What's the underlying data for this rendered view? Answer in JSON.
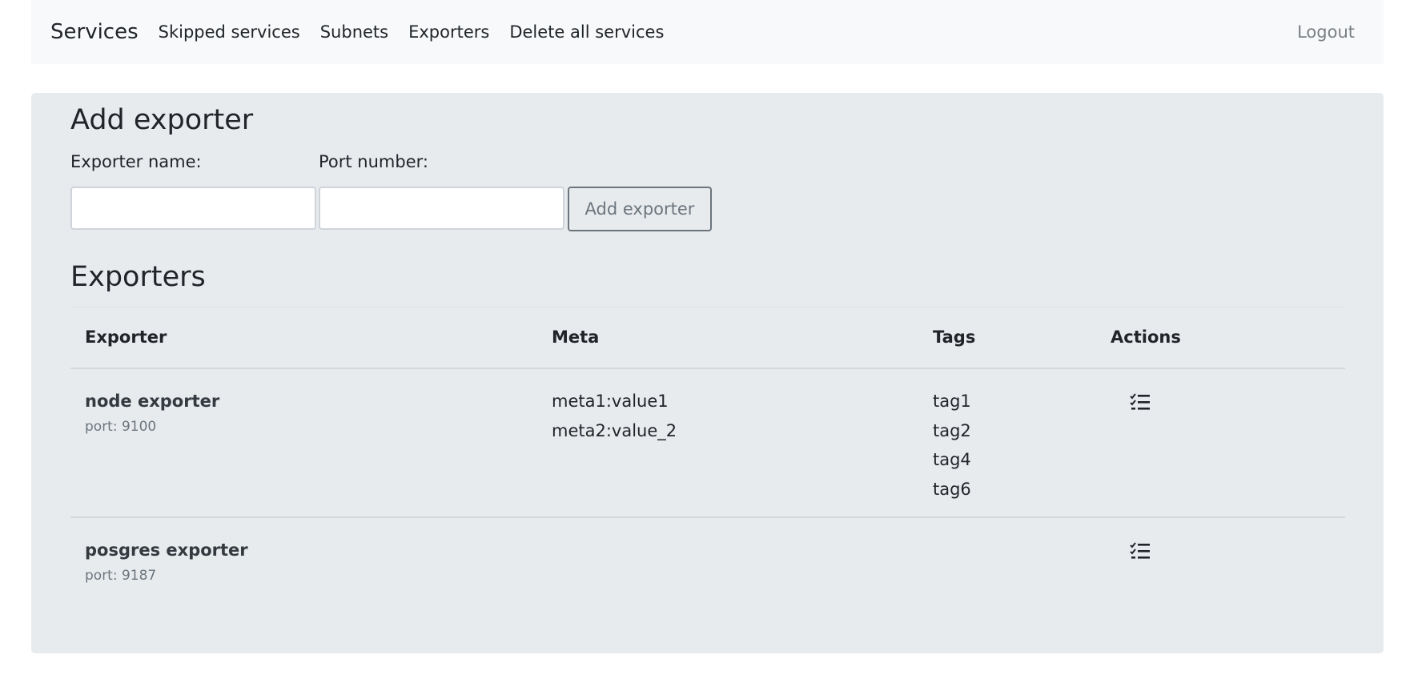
{
  "navbar": {
    "brand": "Services",
    "links": [
      "Skipped services",
      "Subnets",
      "Exporters",
      "Delete all services"
    ],
    "logout": "Logout"
  },
  "add_form": {
    "title": "Add exporter",
    "name_label": "Exporter name:",
    "port_label": "Port number:",
    "name_value": "",
    "port_value": "",
    "submit_label": "Add exporter"
  },
  "exporters": {
    "title": "Exporters",
    "columns": [
      "Exporter",
      "Meta",
      "Tags",
      "Actions"
    ],
    "rows": [
      {
        "name": "node exporter",
        "port": "port: 9100",
        "meta": [
          "meta1:value1",
          "meta2:value_2"
        ],
        "tags": [
          "tag1",
          "tag2",
          "tag4",
          "tag6"
        ],
        "action_icon": "checklist-icon"
      },
      {
        "name": "posgres exporter",
        "port": "port: 9187",
        "meta": [],
        "tags": [],
        "action_icon": "checklist-icon"
      }
    ]
  }
}
